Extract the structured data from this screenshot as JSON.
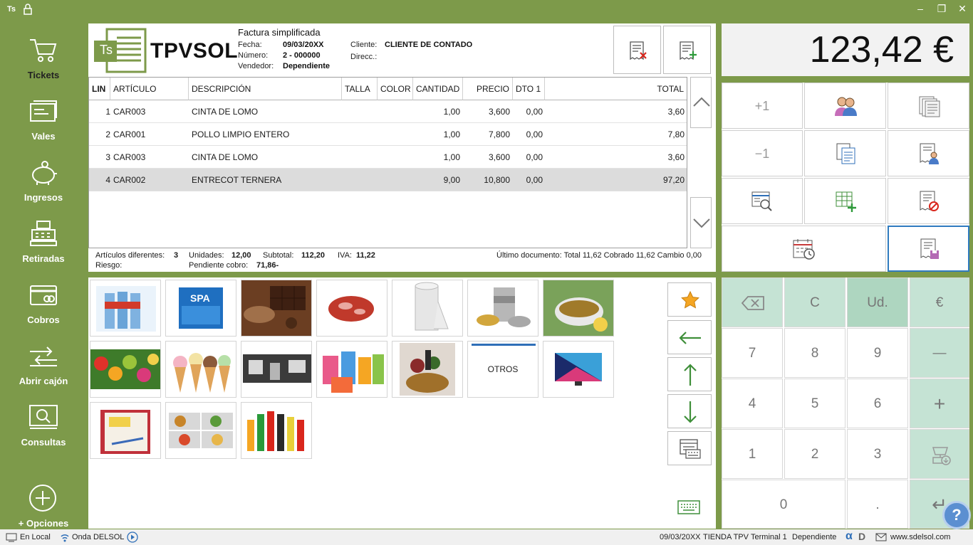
{
  "app": {
    "short": "Ts",
    "brand": "TPVSOL",
    "logo_letters": "Ts"
  },
  "window": {
    "minimize": "–",
    "restore": "❐",
    "close": "✕"
  },
  "sidebar": [
    {
      "label": "Tickets",
      "icon": "cart-icon"
    },
    {
      "label": "Vales",
      "icon": "voucher-icon"
    },
    {
      "label": "Ingresos",
      "icon": "piggy-bank-icon"
    },
    {
      "label": "Retiradas",
      "icon": "cash-register-icon"
    },
    {
      "label": "Cobros",
      "icon": "card-icon"
    },
    {
      "label": "Abrir cajón",
      "icon": "drawer-icon"
    },
    {
      "label": "Consultas",
      "icon": "search-icon"
    },
    {
      "label": "+ Opciones",
      "icon": "plus-circle-icon"
    }
  ],
  "document": {
    "type": "Factura simplificada",
    "fecha_label": "Fecha:",
    "fecha": "09/03/20XX",
    "numero_label": "Número:",
    "numero": "2 - 000000",
    "vendedor_label": "Vendedor:",
    "vendedor": "Dependiente",
    "cliente_label": "Cliente:",
    "cliente": "CLIENTE DE CONTADO",
    "direcc_label": "Direcc.:",
    "direcc": ""
  },
  "grid": {
    "headers": [
      "LIN",
      "ARTÍCULO",
      "DESCRIPCIÓN",
      "TALLA",
      "COLOR",
      "CANTIDAD",
      "PRECIO",
      "DTO 1",
      "TOTAL"
    ],
    "rows": [
      {
        "lin": "1",
        "articulo": "CAR003",
        "descripcion": "CINTA DE LOMO",
        "cantidad": "1,00",
        "precio": "3,600",
        "dto": "0,00",
        "total": "3,60"
      },
      {
        "lin": "2",
        "articulo": "CAR001",
        "descripcion": "POLLO LIMPIO ENTERO",
        "cantidad": "1,00",
        "precio": "7,800",
        "dto": "0,00",
        "total": "7,80"
      },
      {
        "lin": "3",
        "articulo": "CAR003",
        "descripcion": "CINTA DE LOMO",
        "cantidad": "1,00",
        "precio": "3,600",
        "dto": "0,00",
        "total": "3,60"
      },
      {
        "lin": "4",
        "articulo": "CAR002",
        "descripcion": "ENTRECOT TERNERA",
        "cantidad": "9,00",
        "precio": "10,800",
        "dto": "0,00",
        "total": "97,20"
      }
    ]
  },
  "summary": {
    "articulos_label": "Artículos diferentes:",
    "articulos": "3",
    "unidades_label": "Unidades:",
    "unidades": "12,00",
    "subtotal_label": "Subtotal:",
    "subtotal": "112,20",
    "iva_label": "IVA:",
    "iva": "11,22",
    "riesgo_label": "Riesgo:",
    "pendiente_label": "Pendiente cobro:",
    "pendiente": "71,86-",
    "ultimo": "Último documento: Total 11,62 Cobrado 11,62 Cambio 0,00"
  },
  "catalog": {
    "tiles": [
      "water-bottles",
      "spa-water",
      "chocolate",
      "meat",
      "paper-roll",
      "tin-cans",
      "tea",
      "fruits",
      "ice-cream",
      "coffee-machine",
      "cleaning-products",
      "gift-basket",
      "OTROS",
      "televisions",
      "notebook",
      "food-trays",
      "soft-drinks"
    ],
    "otros_label": "OTROS"
  },
  "total": {
    "amount": "123,42 €"
  },
  "functions": {
    "plus_one": "+1",
    "minus_one": "−1"
  },
  "numpad": {
    "backspace": "⌫",
    "clear": "C",
    "unit": "Ud.",
    "euro": "€",
    "k7": "7",
    "k8": "8",
    "k9": "9",
    "minus": "—",
    "k4": "4",
    "k5": "5",
    "k6": "6",
    "plus": "+",
    "k1": "1",
    "k2": "2",
    "k3": "3",
    "k0": "0",
    "dot": ".",
    "enter": "↵"
  },
  "status": {
    "local": "En Local",
    "onda": "Onda DELSOL",
    "date": "09/03/20XX",
    "store": "TIENDA TPV",
    "terminal": "Terminal 1",
    "user": "Dependiente",
    "web": "www.sdelsol.com"
  },
  "colors": {
    "accent": "#7d9a4a",
    "keypad_green": "#c5e3d4",
    "active_border": "#2f7bbf"
  }
}
